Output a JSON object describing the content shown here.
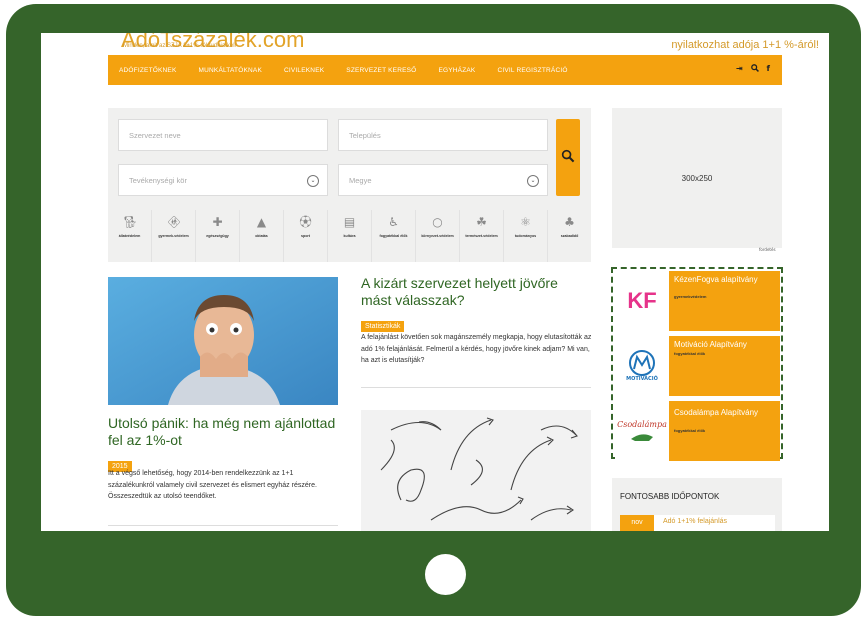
{
  "site": {
    "logo_text": "AdóTszázalék.com",
    "tagline": "Minden, amit az SZJA 1+1%-ról tudnia kell",
    "promo": "nyilatkozhat adója 1+1 %-áról!"
  },
  "nav": {
    "items": [
      "ADÓFIZETŐKNEK",
      "MUNKÁLTATÓKNAK",
      "CIVILEKNEK",
      "SZERVEZET KERESŐ",
      "EGYHÁZAK",
      "CIVIL REGISZTRÁCIÓ"
    ],
    "icons": [
      "login-icon",
      "search-icon",
      "facebook-icon"
    ]
  },
  "search": {
    "org_placeholder": "Szervezet neve",
    "city_placeholder": "Település",
    "activity_placeholder": "Tevékenységi kör",
    "county_placeholder": "Megye"
  },
  "categories": [
    {
      "label": "állatvédelem",
      "icon": "dog-icon"
    },
    {
      "label": "gyermek-védelem",
      "icon": "family-icon"
    },
    {
      "label": "egészségügy",
      "icon": "medkit-icon"
    },
    {
      "label": "oktatás",
      "icon": "graduation-icon"
    },
    {
      "label": "sport",
      "icon": "ball-icon"
    },
    {
      "label": "kultúra",
      "icon": "book-icon"
    },
    {
      "label": "fogyatékkal élők",
      "icon": "wheelchair-icon"
    },
    {
      "label": "környezet-védelem",
      "icon": "recycle-icon"
    },
    {
      "label": "természet-védelem",
      "icon": "leaf-icon"
    },
    {
      "label": "tudományos",
      "icon": "atom-icon"
    },
    {
      "label": "szabadidő",
      "icon": "leisure-icon"
    }
  ],
  "ad": {
    "size_label": "300x250",
    "credit": "fordetés"
  },
  "articles": [
    {
      "title": "Utolsó pánik: ha még nem ajánlottad fel az 1%-ot",
      "tag": "2015",
      "text": "Itt a végső lehetőség, hogy 2014-ben rendelkezzünk az 1+1 százalékunkról valamely civil szervezet és elismert egyház részére. Összeszedtük az utolsó teendőket."
    },
    {
      "title": "A kizárt szervezet helyett jövőre mást válasszak?",
      "tag": "Statisztikák",
      "text": "A felajánlást követően sok magánszemély megkapja, hogy elutasították az adó 1% felajánlását. Felmerül a kérdés, hogy jövőre kinek adjam? Mi van, ha azt is elutasítják?"
    }
  ],
  "featured": [
    {
      "name": "KézenFogva alapítvány",
      "category": "gyermekvédelem",
      "logo_text": "KF"
    },
    {
      "name": "Motiváció Alapítvány",
      "category": "fogyatékkal élők",
      "logo_text": "MOTIVÁCIÓ"
    },
    {
      "name": "Csodalámpa Alapítvány",
      "category": "fogyatékkal élők",
      "logo_text": "Csodalámpa"
    }
  ],
  "dates": {
    "title": "FONTOSABB IDŐPONTOK",
    "month": "nov",
    "event": "Adó 1+1% felajánlás"
  },
  "colors": {
    "frame": "#35642a",
    "accent": "#f4a20f",
    "title_green": "#2f6623"
  }
}
